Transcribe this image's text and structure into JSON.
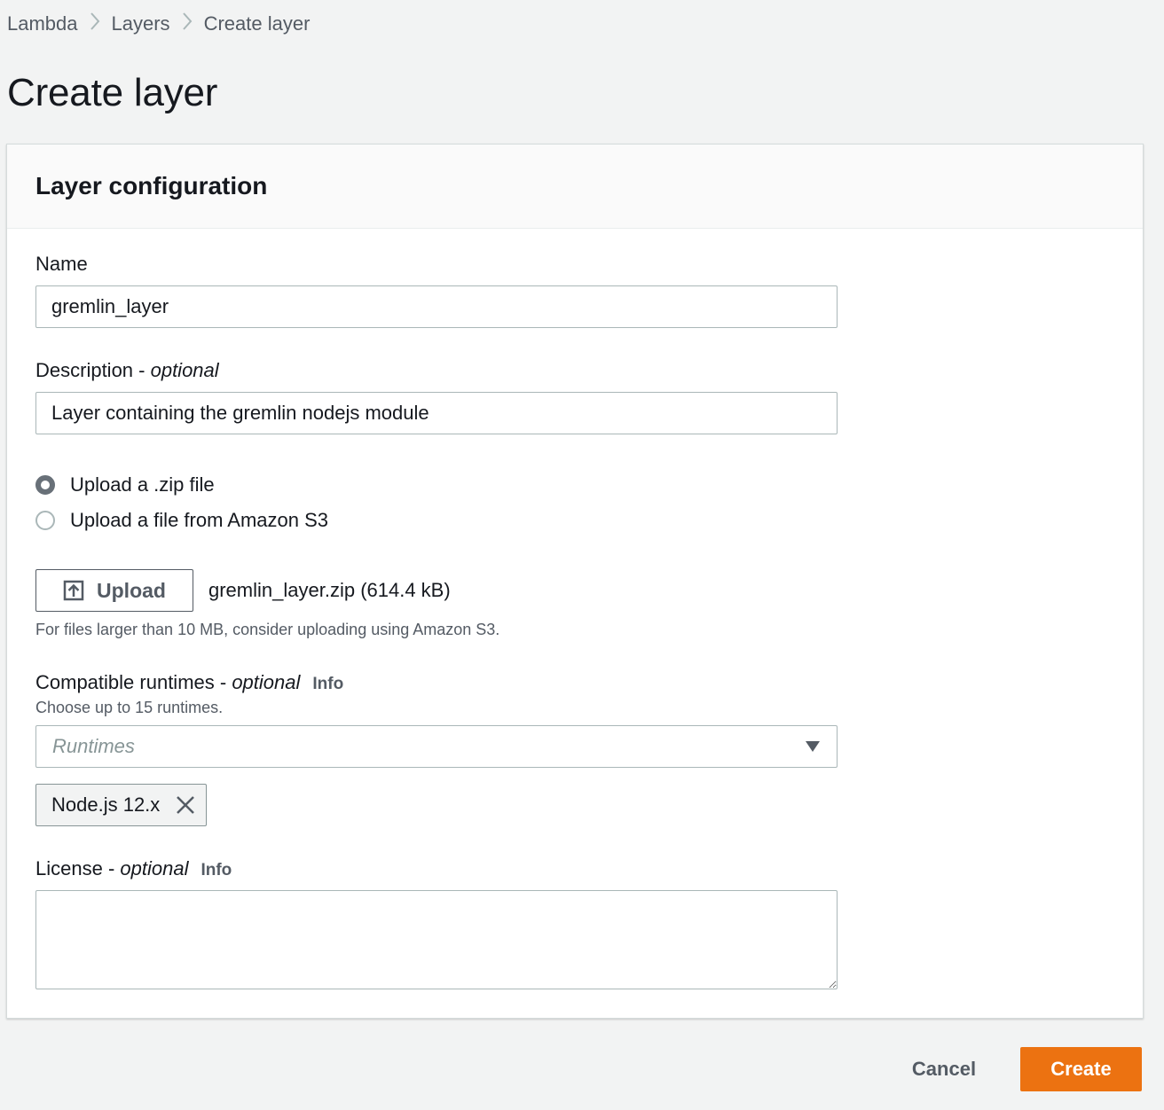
{
  "breadcrumb": {
    "items": [
      "Lambda",
      "Layers",
      "Create layer"
    ],
    "separator": "›"
  },
  "page": {
    "title": "Create layer"
  },
  "panel": {
    "title": "Layer configuration",
    "name": {
      "label": "Name",
      "value": "gremlin_layer"
    },
    "description": {
      "label": "Description - ",
      "optional": "optional",
      "value": "Layer containing the gremlin nodejs module"
    },
    "source_options": [
      {
        "label": "Upload a .zip file",
        "checked": true
      },
      {
        "label": "Upload a file from Amazon S3",
        "checked": false
      }
    ],
    "upload": {
      "button_label": "Upload",
      "file_name": "gremlin_layer.zip (614.4 kB)",
      "hint": "For files larger than 10 MB, consider uploading using Amazon S3."
    },
    "runtimes": {
      "label": "Compatible runtimes - ",
      "optional": "optional",
      "info": "Info",
      "hint": "Choose up to 15 runtimes.",
      "placeholder": "Runtimes",
      "selected": [
        "Node.js 12.x"
      ]
    },
    "license": {
      "label": "License - ",
      "optional": "optional",
      "info": "Info",
      "value": ""
    }
  },
  "actions": {
    "cancel": "Cancel",
    "create": "Create"
  },
  "colors": {
    "primary_button": "#ec7211",
    "page_background": "#f2f3f3",
    "panel_header": "#fafafa",
    "text": "#16191f",
    "secondary_text": "#545b64"
  }
}
